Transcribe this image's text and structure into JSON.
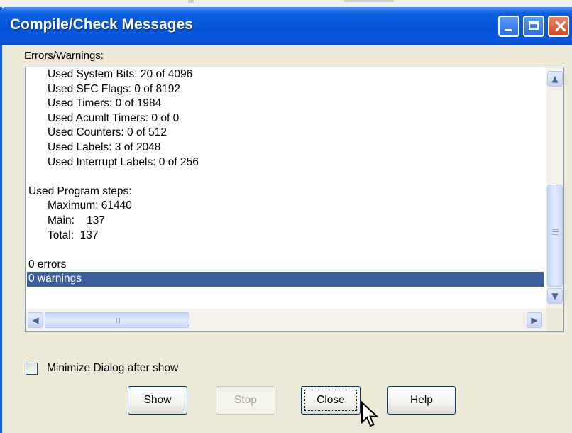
{
  "window": {
    "title": "Compile/Check Messages",
    "colors": {
      "titlebar": "#0a60e0",
      "selection": "#3d5f9c",
      "face": "#ece9d8"
    }
  },
  "messages": {
    "group_label": "Errors/Warnings:",
    "lines": [
      {
        "text": "Used System Bits: 20 of 4096",
        "indent": true,
        "selected": false
      },
      {
        "text": "Used SFC Flags: 0 of 8192",
        "indent": true,
        "selected": false
      },
      {
        "text": "Used Timers: 0 of 1984",
        "indent": true,
        "selected": false
      },
      {
        "text": "Used Acumlt Timers: 0 of 0",
        "indent": true,
        "selected": false
      },
      {
        "text": "Used Counters: 0 of 512",
        "indent": true,
        "selected": false
      },
      {
        "text": "Used Labels: 3 of 2048",
        "indent": true,
        "selected": false
      },
      {
        "text": "Used Interrupt Labels: 0 of 256",
        "indent": true,
        "selected": false
      },
      {
        "text": "",
        "indent": false,
        "selected": false
      },
      {
        "text": "Used Program steps:",
        "indent": false,
        "selected": false
      },
      {
        "text": "Maximum: 61440",
        "indent": true,
        "selected": false
      },
      {
        "text": "Main:    137",
        "indent": true,
        "selected": false
      },
      {
        "text": "Total:  137",
        "indent": true,
        "selected": false
      },
      {
        "text": "",
        "indent": false,
        "selected": false
      },
      {
        "text": "0 errors",
        "indent": false,
        "selected": false
      },
      {
        "text": "0 warnings",
        "indent": false,
        "selected": true
      }
    ]
  },
  "options": {
    "minimize_label": "Minimize  Dialog after show",
    "minimize_checked": false
  },
  "buttons": {
    "show": "Show",
    "stop": "Stop",
    "close": "Close",
    "help": "Help"
  }
}
